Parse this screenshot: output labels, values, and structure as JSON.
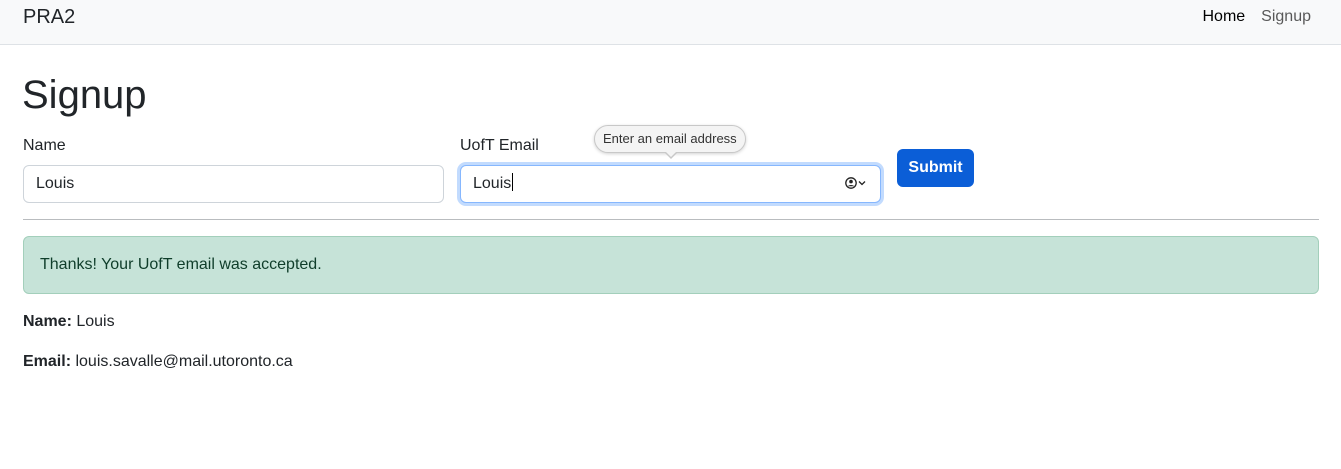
{
  "navbar": {
    "brand": "PRA2",
    "links": [
      {
        "label": "Home",
        "active": true
      },
      {
        "label": "Signup",
        "active": false
      }
    ]
  },
  "page": {
    "title": "Signup"
  },
  "form": {
    "name_label": "Name",
    "name_value": "Louis",
    "email_label": "UofT Email",
    "email_value": "Louis",
    "email_tooltip": "Enter an email address",
    "autofill_icon": "contact-autofill-icon",
    "submit_label": "Submit"
  },
  "alert": {
    "message": "Thanks! Your UofT email was accepted.",
    "color": "#c6e3d8"
  },
  "result": {
    "name_label": "Name:",
    "name_value": "Louis",
    "email_label": "Email:",
    "email_value": "louis.savalle@mail.utoronto.ca"
  },
  "colors": {
    "primary": "#0b5ed7",
    "navbar_bg": "#f8f9fa",
    "focus_ring": "#86b7fe"
  }
}
